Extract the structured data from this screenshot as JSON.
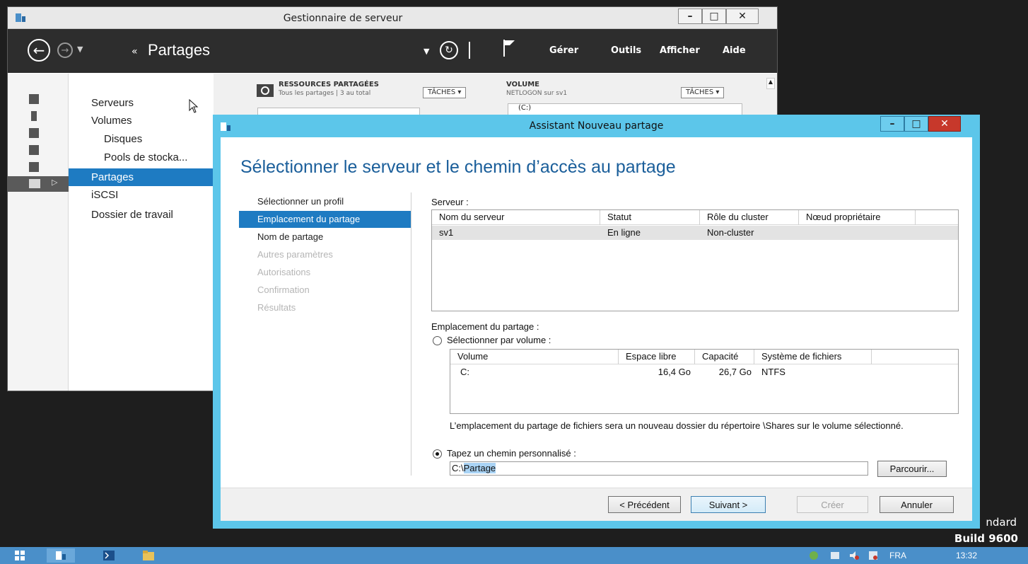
{
  "desktop": {
    "edition_fragment": "ndard",
    "build": "Build 9600"
  },
  "server_manager": {
    "title": "Gestionnaire de serveur",
    "header_title": "Partages",
    "menu": [
      "Gérer",
      "Outils",
      "Afficher",
      "Aide"
    ],
    "nav": {
      "servers": "Serveurs",
      "volumes": "Volumes",
      "disks": "Disques",
      "pools": "Pools de stocka...",
      "shares": "Partages",
      "iscsi": "iSCSI",
      "work_folders": "Dossier de travail"
    },
    "content": {
      "resources_title": "RESSOURCES PARTAGÉES",
      "resources_sub": "Tous les partages | 3 au total",
      "tasks_label": "TÂCHES",
      "volume_title": "VOLUME",
      "volume_sub": "NETLOGON sur sv1",
      "volume_drive": "(C:)"
    }
  },
  "wizard": {
    "title": "Assistant Nouveau partage",
    "heading": "Sélectionner le serveur et le chemin d’accès au partage",
    "steps": [
      {
        "label": "Sélectionner un profil",
        "state": "normal"
      },
      {
        "label": "Emplacement du partage",
        "state": "active"
      },
      {
        "label": "Nom de partage",
        "state": "normal"
      },
      {
        "label": "Autres paramètres",
        "state": "disabled"
      },
      {
        "label": "Autorisations",
        "state": "disabled"
      },
      {
        "label": "Confirmation",
        "state": "disabled"
      },
      {
        "label": "Résultats",
        "state": "disabled"
      }
    ],
    "server_label": "Serveur :",
    "server_grid": {
      "columns": [
        "Nom du serveur",
        "Statut",
        "Rôle du cluster",
        "Nœud propriétaire"
      ],
      "rows": [
        [
          "sv1",
          "En ligne",
          "Non-cluster",
          ""
        ]
      ]
    },
    "location_label": "Emplacement du partage :",
    "option_volume": "Sélectionner par volume :",
    "volume_grid": {
      "columns": [
        "Volume",
        "Espace libre",
        "Capacité",
        "Système de fichiers"
      ],
      "rows": [
        [
          "C:",
          "16,4 Go",
          "26,7 Go",
          "NTFS"
        ]
      ]
    },
    "location_note": "L’emplacement du partage de fichiers sera un nouveau dossier du répertoire \\Shares sur le volume sélectionné.",
    "option_custom": "Tapez un chemin personnalisé :",
    "path_prefix": "C:\\",
    "path_selected": "Partage",
    "browse_label": "Parcourir...",
    "buttons": {
      "previous": "< Précédent",
      "next": "Suivant >",
      "create": "Créer",
      "cancel": "Annuler"
    }
  },
  "taskbar": {
    "language": "FRA",
    "time": "13:32"
  },
  "colors": {
    "accent": "#1e7bc2",
    "wizard_frame": "#5cc6ea",
    "taskbar": "#4a8fc9",
    "close": "#c0392b"
  }
}
